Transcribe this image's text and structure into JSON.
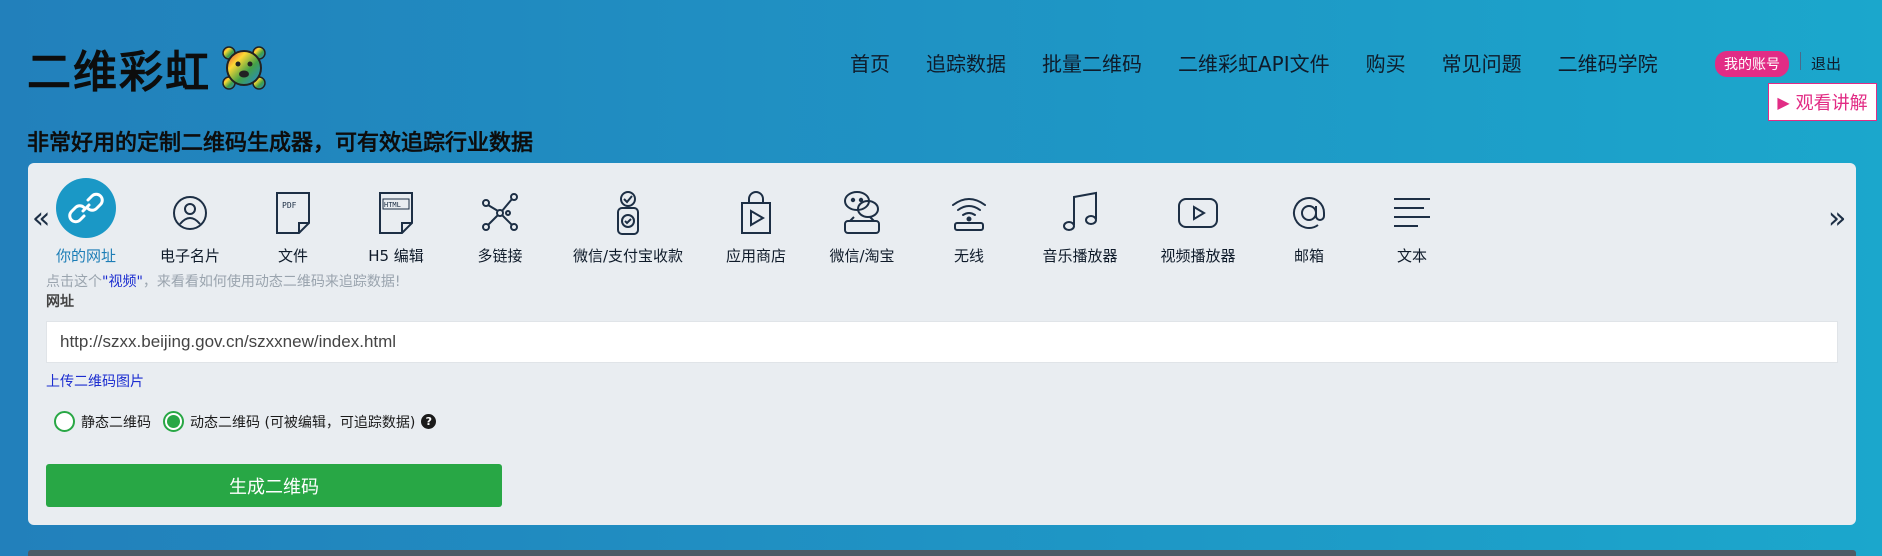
{
  "brand": {
    "name": "二维彩虹"
  },
  "nav": [
    "首页",
    "追踪数据",
    "批量二维码",
    "二维彩虹API文件",
    "购买",
    "常见问题",
    "二维码学院"
  ],
  "account": {
    "my_account": "我的账号",
    "logout": "退出",
    "watch_label": "观看讲解"
  },
  "tagline": "非常好用的定制二维码生成器，可有效追踪行业数据",
  "categories": [
    {
      "label": "你的网址",
      "icon": "link-icon",
      "active": true
    },
    {
      "label": "电子名片",
      "icon": "person-icon"
    },
    {
      "label": "文件",
      "icon": "pdf-file-icon"
    },
    {
      "label": "H5 编辑",
      "icon": "html-file-icon"
    },
    {
      "label": "多链接",
      "icon": "network-icon"
    },
    {
      "label": "微信/支付宝收款",
      "icon": "payment-icon"
    },
    {
      "label": "应用商店",
      "icon": "app-store-icon"
    },
    {
      "label": "微信/淘宝",
      "icon": "wechat-icon"
    },
    {
      "label": "无线",
      "icon": "wifi-icon"
    },
    {
      "label": "音乐播放器",
      "icon": "music-icon"
    },
    {
      "label": "视频播放器",
      "icon": "video-icon"
    },
    {
      "label": "邮箱",
      "icon": "at-icon"
    },
    {
      "label": "文本",
      "icon": "text-icon"
    }
  ],
  "form": {
    "hint_prefix": "点击这个",
    "hint_link": "\"视频\"",
    "hint_suffix": "，来看看如何使用动态二维码来追踪数据!",
    "url_label": "网址",
    "url_value": "http://szxx.beijing.gov.cn/szxxnew/index.html",
    "upload_link": "上传二维码图片",
    "static_label": "静态二维码",
    "dynamic_label": "动态二维码 (可被编辑，可追踪数据)",
    "help_mark": "?",
    "generate_label": "生成二维码"
  },
  "colors": {
    "accent": "#1a98c6",
    "pink": "#e22c85",
    "green": "#28a745"
  }
}
